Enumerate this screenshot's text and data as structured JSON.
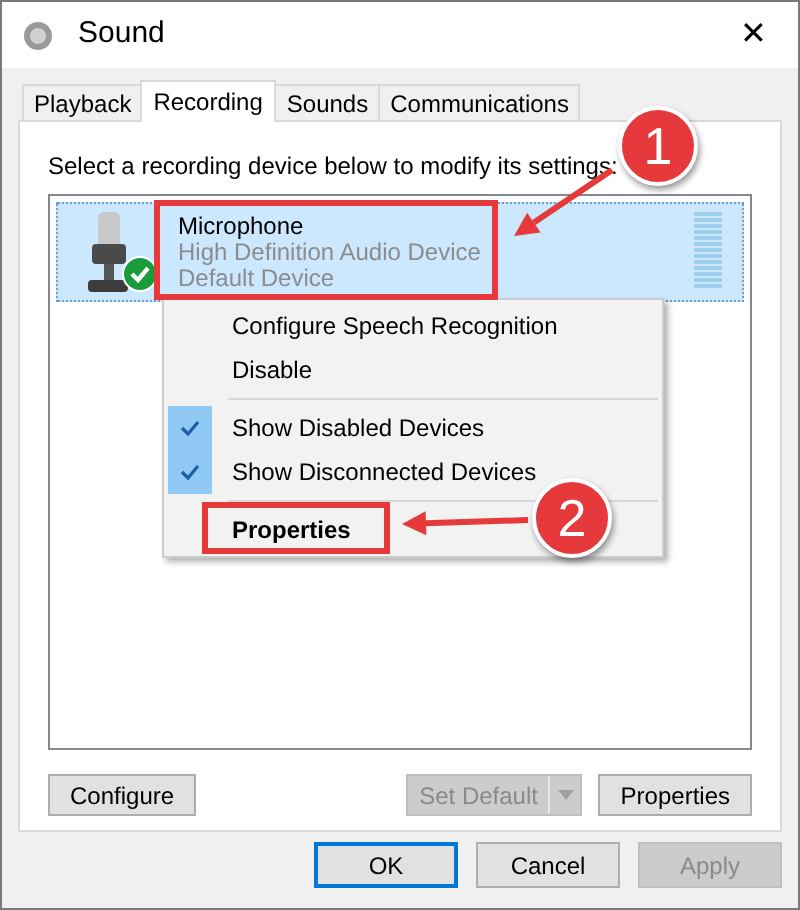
{
  "window": {
    "title": "Sound",
    "close": "✕"
  },
  "tabs": [
    {
      "label": "Playback",
      "selected": false
    },
    {
      "label": "Recording",
      "selected": true
    },
    {
      "label": "Sounds",
      "selected": false
    },
    {
      "label": "Communications",
      "selected": false
    }
  ],
  "instruction": "Select a recording device below to modify its settings:",
  "devices": [
    {
      "name": "Microphone",
      "description": "High Definition Audio Device",
      "status": "Default Device",
      "selected": true,
      "default": true
    }
  ],
  "context_menu": [
    {
      "kind": "item",
      "label": "Configure Speech Recognition",
      "checked": false,
      "default": false
    },
    {
      "kind": "item",
      "label": "Disable",
      "checked": false,
      "default": false
    },
    {
      "kind": "separator"
    },
    {
      "kind": "item",
      "label": "Show Disabled Devices",
      "checked": true,
      "default": false
    },
    {
      "kind": "item",
      "label": "Show Disconnected Devices",
      "checked": true,
      "default": false
    },
    {
      "kind": "separator"
    },
    {
      "kind": "item",
      "label": "Properties",
      "checked": false,
      "default": true
    }
  ],
  "panel_buttons": [
    {
      "label": "Configure",
      "disabled": false,
      "kind": "button"
    },
    {
      "label": "Set Default",
      "disabled": true,
      "kind": "split"
    },
    {
      "label": "Properties",
      "disabled": false,
      "kind": "button"
    }
  ],
  "dialog_buttons": [
    {
      "label": "OK",
      "disabled": false,
      "focused": true
    },
    {
      "label": "Cancel",
      "disabled": false,
      "focused": false
    },
    {
      "label": "Apply",
      "disabled": true,
      "focused": false
    }
  ],
  "annotations": [
    {
      "label": "1"
    },
    {
      "label": "2"
    }
  ]
}
